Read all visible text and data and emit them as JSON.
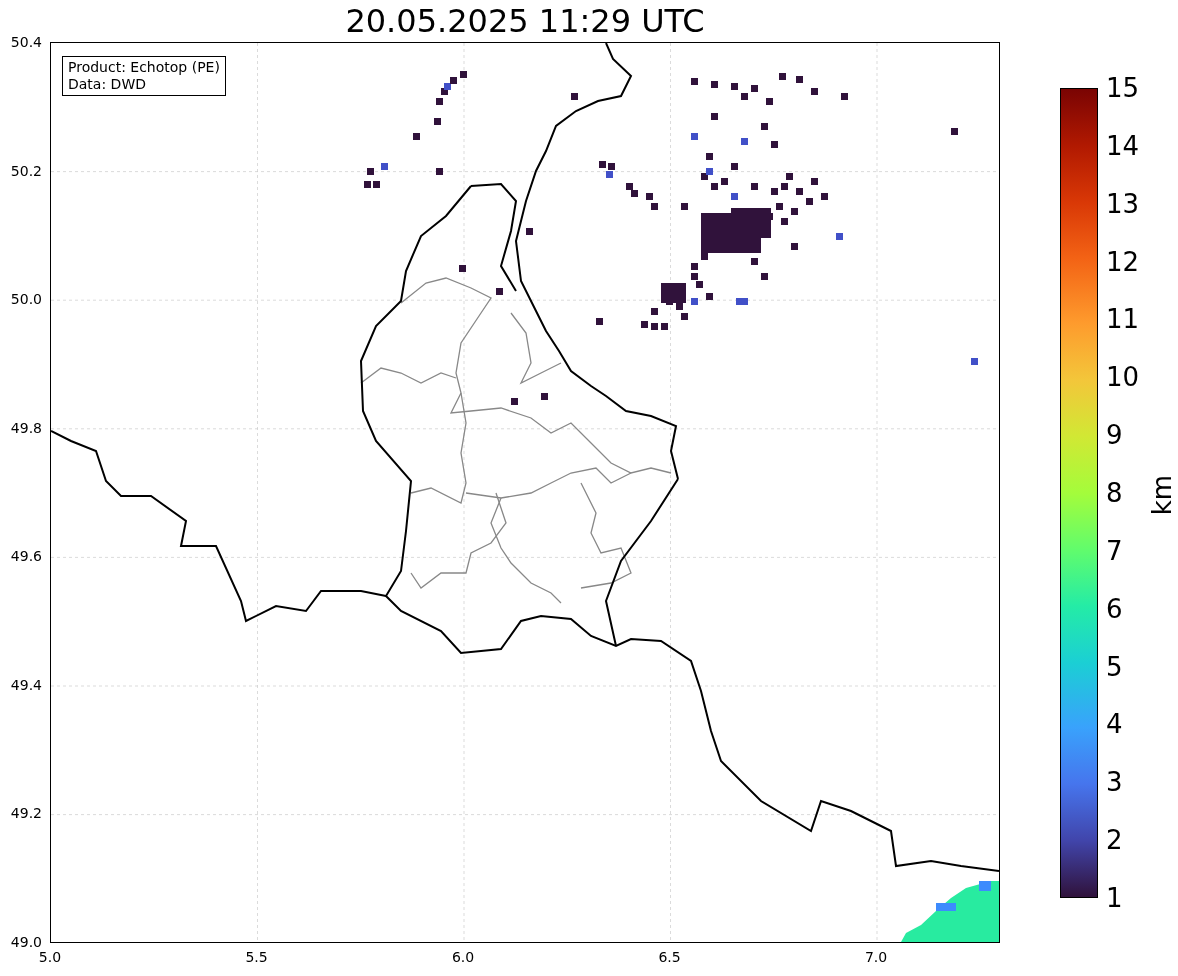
{
  "title": "20.05.2025 11:29 UTC",
  "legend": [
    "Product: Echotop (PE)",
    "Data: DWD"
  ],
  "x_ticks": [
    "5.0",
    "5.5",
    "6.0",
    "6.5",
    "7.0"
  ],
  "y_ticks": [
    "50.4",
    "50.2",
    "50.0",
    "49.8",
    "49.6",
    "49.4",
    "49.2",
    "49.0"
  ],
  "colorbar": {
    "label": "km",
    "ticks": [
      "15",
      "14",
      "13",
      "12",
      "11",
      "10",
      "9",
      "8",
      "7",
      "6",
      "5",
      "4",
      "3",
      "2",
      "1"
    ]
  }
}
